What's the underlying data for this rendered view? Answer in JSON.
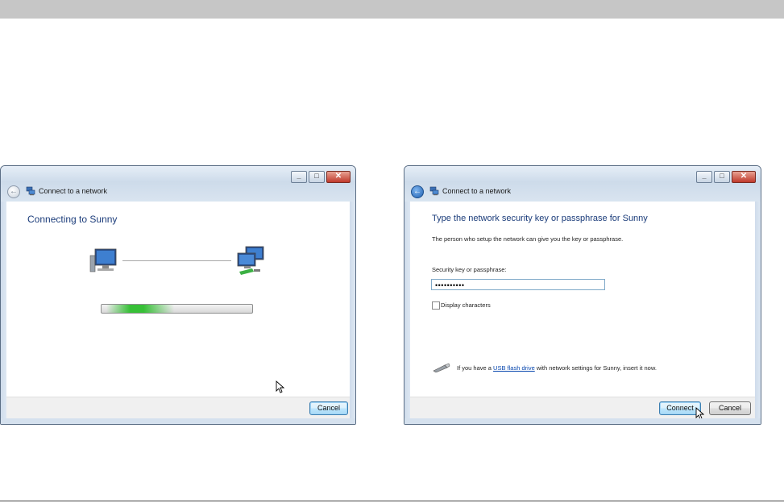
{
  "left_window": {
    "title": "Connect to a network",
    "heading": "Connecting to Sunny",
    "progress": 0.45,
    "buttons": {
      "cancel": "Cancel"
    }
  },
  "right_window": {
    "title": "Connect to a network",
    "heading": "Type the network security key or passphrase for Sunny",
    "description": "The person who setup the network can give you the key or passphrase.",
    "key_label": "Security key or passphrase:",
    "key_value": "••••••••••",
    "display_characters_label": "Display characters",
    "display_characters_checked": false,
    "usb_prefix": "If you have a",
    "usb_link": "USB flash drive",
    "usb_suffix": "with network settings for Sunny, insert it now.",
    "buttons": {
      "connect": "Connect",
      "cancel": "Cancel"
    }
  },
  "icons": [
    "back-arrow-icon",
    "network-icon",
    "computer-icon",
    "network-computers-icon",
    "usb-drive-icon",
    "mouse-cursor-icon"
  ],
  "colors": {
    "heading": "#1b3c7a",
    "progress_fill": "#37c037",
    "link": "#0645ad",
    "close_button": "#c0392b"
  }
}
